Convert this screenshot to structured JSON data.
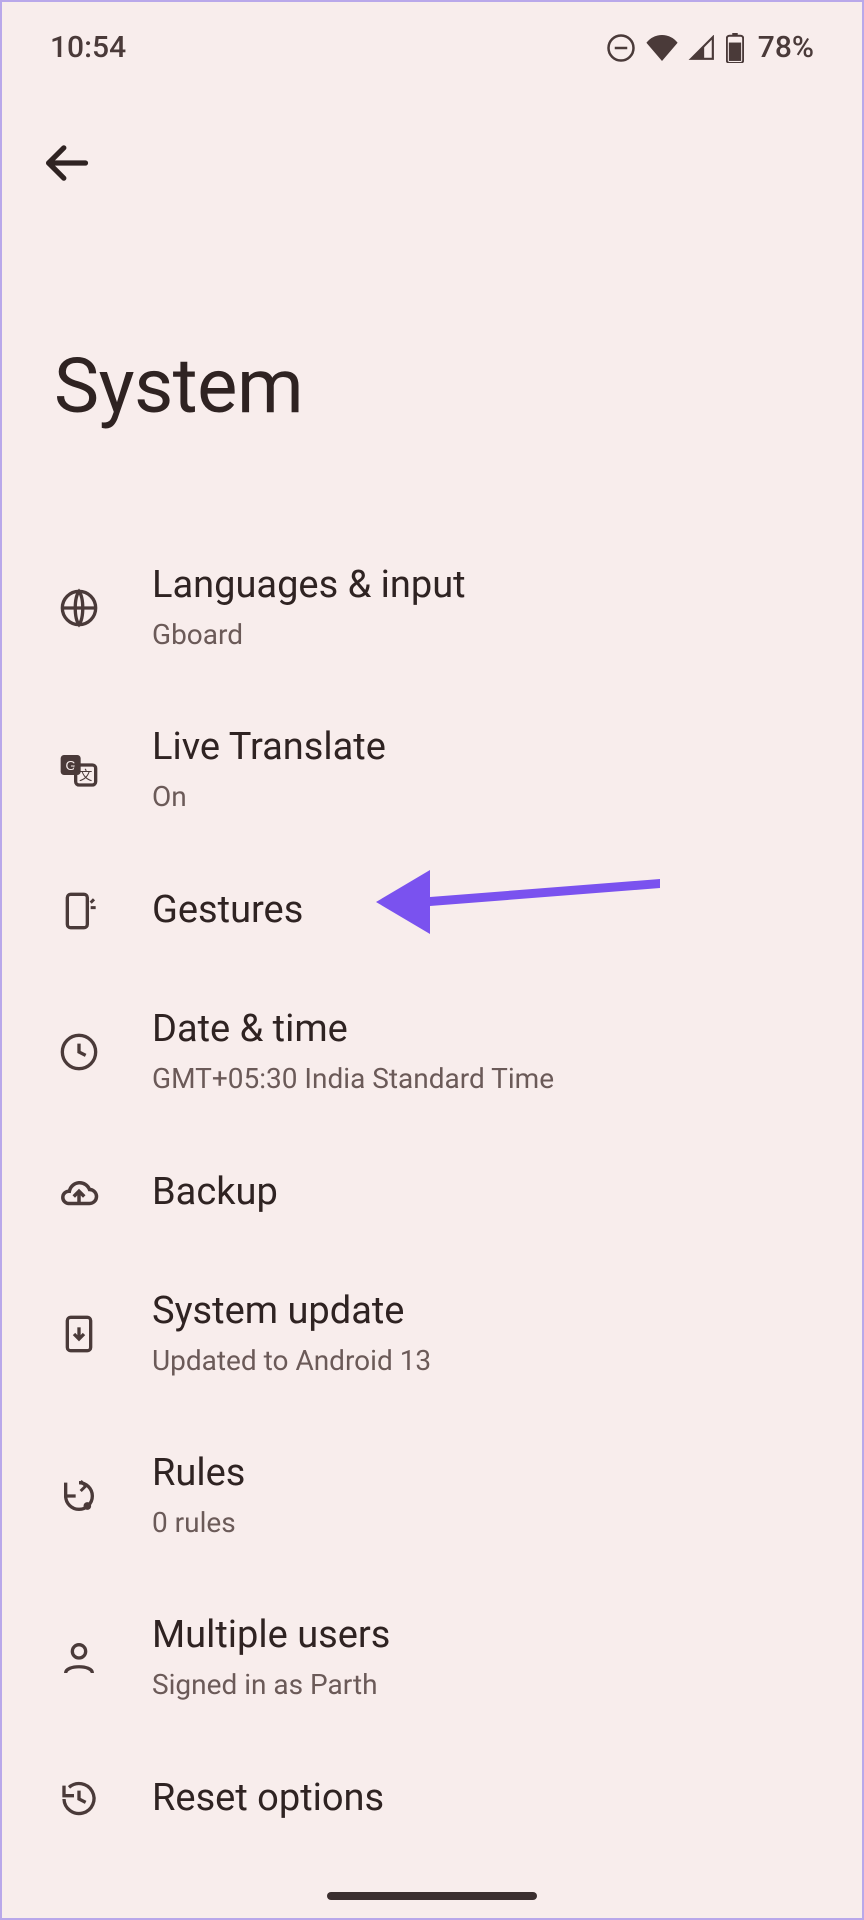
{
  "status": {
    "time": "10:54",
    "battery_percent": "78%"
  },
  "header": {
    "title": "System"
  },
  "items": [
    {
      "title": "Languages & input",
      "subtitle": "Gboard"
    },
    {
      "title": "Live Translate",
      "subtitle": "On"
    },
    {
      "title": "Gestures",
      "subtitle": ""
    },
    {
      "title": "Date & time",
      "subtitle": "GMT+05:30 India Standard Time"
    },
    {
      "title": "Backup",
      "subtitle": ""
    },
    {
      "title": "System update",
      "subtitle": "Updated to Android 13"
    },
    {
      "title": "Rules",
      "subtitle": "0 rules"
    },
    {
      "title": "Multiple users",
      "subtitle": "Signed in as Parth"
    },
    {
      "title": "Reset options",
      "subtitle": ""
    }
  ]
}
